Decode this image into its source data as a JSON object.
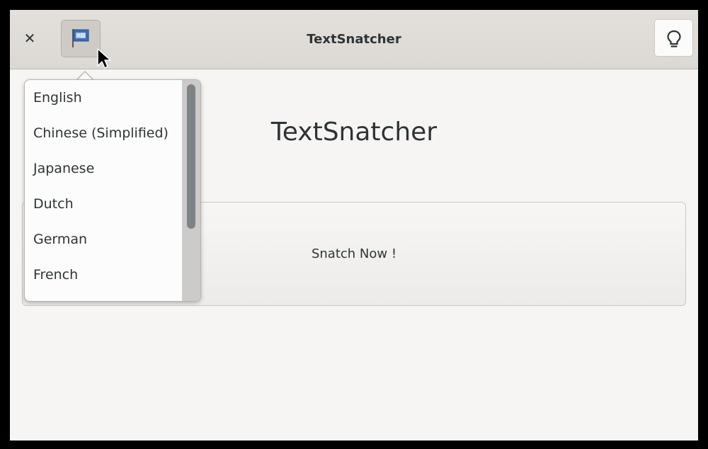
{
  "window": {
    "title": "TextSnatcher"
  },
  "headerbar": {
    "close_icon": "close-icon",
    "language_icon": "flag-icon",
    "tips_icon": "lightbulb-icon"
  },
  "main": {
    "app_title": "TextSnatcher",
    "snatch_button_label": "Snatch Now !"
  },
  "language_menu": {
    "items": [
      {
        "label": "English"
      },
      {
        "label": "Chinese (Simplified)"
      },
      {
        "label": "Japanese"
      },
      {
        "label": "Dutch"
      },
      {
        "label": "German"
      },
      {
        "label": "French"
      }
    ]
  },
  "colors": {
    "background": "#f6f5f4",
    "headerbar": "#dfdbd7",
    "text": "#2e3436",
    "flag_blue": "#3c6eb4"
  }
}
